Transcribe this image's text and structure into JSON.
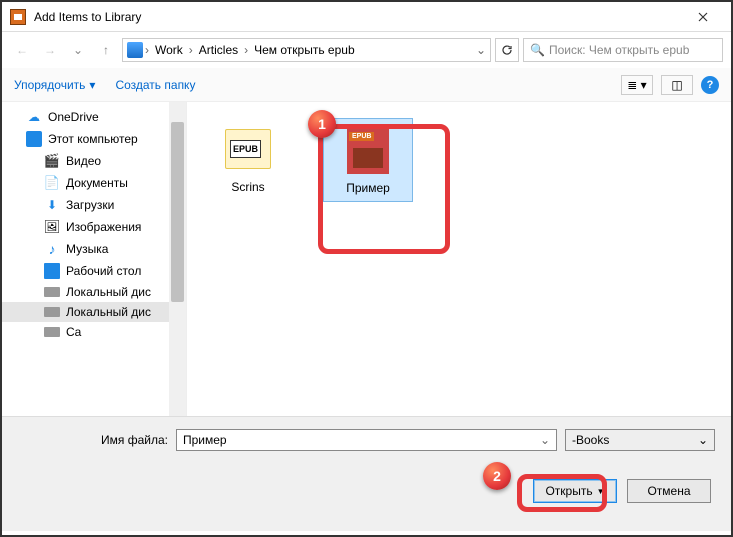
{
  "window": {
    "title": "Add Items to Library"
  },
  "breadcrumb": {
    "items": [
      "Work",
      "Articles",
      "Чем открыть epub"
    ]
  },
  "search": {
    "placeholder": "Поиск: Чем открыть epub"
  },
  "toolbar": {
    "organize": "Упорядочить",
    "new_folder": "Создать папку"
  },
  "sidebar": {
    "items": [
      {
        "label": "OneDrive",
        "icon": "cloud",
        "indent": 1
      },
      {
        "label": "Этот компьютер",
        "icon": "pc",
        "indent": 1
      },
      {
        "label": "Видео",
        "icon": "video",
        "indent": 2
      },
      {
        "label": "Документы",
        "icon": "docs",
        "indent": 2
      },
      {
        "label": "Загрузки",
        "icon": "down",
        "indent": 2
      },
      {
        "label": "Изображения",
        "icon": "pics",
        "indent": 2
      },
      {
        "label": "Музыка",
        "icon": "music",
        "indent": 2
      },
      {
        "label": "Рабочий стол",
        "icon": "desk",
        "indent": 2
      },
      {
        "label": "Локальный дис",
        "icon": "drive",
        "indent": 2
      },
      {
        "label": "Локальный дис",
        "icon": "drive",
        "indent": 2,
        "selected": true
      },
      {
        "label": "Ca",
        "icon": "drive",
        "indent": 2
      }
    ]
  },
  "files": {
    "items": [
      {
        "name": "Scrins",
        "type": "folder",
        "selected": false
      },
      {
        "name": "Пример",
        "type": "epub",
        "selected": true
      }
    ]
  },
  "footer": {
    "filename_label": "Имя файла:",
    "filename_value": "Пример",
    "filetype": "-Books",
    "open": "Открыть",
    "cancel": "Отмена"
  },
  "callouts": {
    "one": "1",
    "two": "2"
  }
}
